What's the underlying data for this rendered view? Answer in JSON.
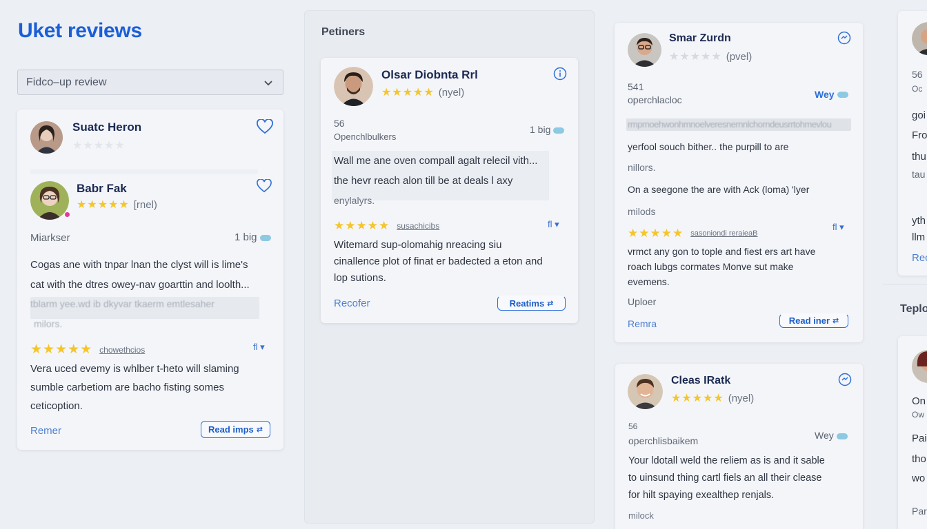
{
  "app": {
    "title": "Uket reviews"
  },
  "filter": {
    "value": "Fidco–up review"
  },
  "left_card": {
    "top": {
      "name": "Suatc Heron"
    },
    "main": {
      "name": "Babr Fak",
      "rating_note": "[rnel)",
      "meta_left": "Miarkser",
      "meta_right": "1 big",
      "text": [
        "Cogas ane with tnpar lnan the clyst will is lime's",
        "cat with the dtres owey-nav goarttin and loolth..."
      ],
      "blur_line": "tblarm yee.wd ib dkyvar tkaerm emtlesaher",
      "blur_line2": "milors.",
      "tag": "chowethcios",
      "tag_icon": "fl",
      "text2": [
        "Vera uced evemy is whlber t-heto will slaming",
        "sumble carbetiom are bacho fisting somes",
        "ceticoption."
      ],
      "footer_link": "Remer",
      "button": "Read imps"
    }
  },
  "middle_panel": {
    "title": "Petiners",
    "card": {
      "name": "Olsar Diobnta Rrl",
      "rating_note": "(nyel)",
      "meta_num": "56",
      "meta_sub": "Openchlbulkers",
      "meta_right": "1 big",
      "text": [
        "Wall me ane oven compall agalt relecil vith...",
        "the hevr reach alon till be at deals l axy",
        "enylalyrs."
      ],
      "tag": "susachicibs",
      "tag_icon": "fl",
      "text2": [
        "Witemard sup-olomahig nreacing siu",
        "cinallence plot of finat er badected a eton and",
        "lop sutions."
      ],
      "footer_link": "Recofer",
      "button": "Reatims"
    }
  },
  "right_column": {
    "card1": {
      "name": "Smar Zurdn",
      "rating_note": "(pvel)",
      "meta_num": "541",
      "meta_sub": "operchlacloc",
      "meta_right": "Wey",
      "blur_line": "rmprnoehwonhmnoelveresnernnlchorndeusrrtohmevlou",
      "text": [
        "yerfool souch bither.. the purpill to are",
        "nillors."
      ],
      "text_b": "On a seegone the are with Ack (loma) 'lyer",
      "text_b2": "milods",
      "tag": "sasoniondi reraieaB",
      "tag_icon": "fl",
      "text2": [
        "vrmct any gon to tople and fiest ers art have",
        "roach lubgs cormates Monve sut make",
        "evemens."
      ],
      "sub_label": "Uploer",
      "footer_link": "Remra",
      "button": "Read iner"
    },
    "card2": {
      "name": "Cleas IRatk",
      "rating_note": "(nyel)",
      "meta_num": "56",
      "meta_sub": "operchlisbaikem",
      "meta_right": "Wey",
      "text": [
        "Your ldotall weld the reliem as is and it sable",
        "to uinsund thing cartl fiels an all their clease",
        "for hilt spaying exealthep renjals."
      ],
      "footer_note": "milock"
    }
  },
  "far_right": {
    "lines": [
      "56",
      "Oc",
      "goi",
      "Fro",
      "thu",
      "tau",
      "yth",
      "llm",
      "Rec"
    ],
    "section_title": "Teplo",
    "lines2": [
      "On",
      "Ow",
      "Pai",
      "tho",
      "wo",
      "Par"
    ]
  },
  "colors": {
    "accent": "#1a5fd8",
    "star": "#f5c52a",
    "link": "#4d7fd0"
  },
  "icons": [
    "chevron-down-icon",
    "heart-icon",
    "info-icon",
    "translate-icon",
    "stats-pill-icon",
    "swap-icon"
  ]
}
